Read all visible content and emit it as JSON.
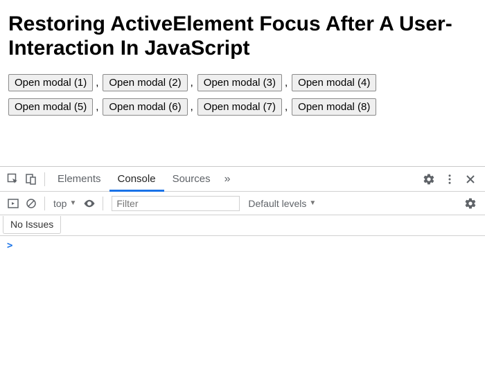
{
  "title": "Restoring ActiveElement Focus After A User-Interaction In JavaScript",
  "buttons": {
    "row1": [
      "Open modal (1)",
      "Open modal (2)",
      "Open modal (3)",
      "Open modal (4)"
    ],
    "row2": [
      "Open modal (5)",
      "Open modal (6)",
      "Open modal (7)",
      "Open modal (8)"
    ]
  },
  "sep": ",",
  "devtools": {
    "tabs": {
      "elements": "Elements",
      "console": "Console",
      "sources": "Sources",
      "overflow": "»"
    },
    "toolbar": {
      "context": "top",
      "filter_placeholder": "Filter",
      "levels": "Default levels"
    },
    "issues_label": "No Issues",
    "prompt": ">"
  }
}
